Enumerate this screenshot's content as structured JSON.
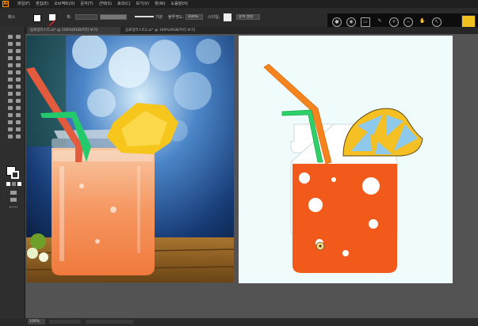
{
  "app": {
    "logo_text": "Ai"
  },
  "menu": {
    "items": [
      "파일(F)",
      "편집(E)",
      "오브젝트(O)",
      "문자(T)",
      "선택(S)",
      "효과(C)",
      "보기(V)",
      "창(W)",
      "도움말(H)"
    ]
  },
  "control_bar": {
    "selection_label": "패스",
    "stroke_label": "획:",
    "brush_label": "기본",
    "opacity_label": "불투명도:",
    "opacity_value": "100%",
    "style_label": "스타일:",
    "doc_setup": "문서 설정"
  },
  "tabs": [
    {
      "label": "음료일러스트.ai* @ 100%(RGB/미리 보기)"
    },
    {
      "label": "음료일러스트2.ai* @ 100%(RGB/미리 보기)"
    }
  ],
  "status": {
    "zoom": "100%"
  },
  "icons": {
    "recorder": [
      "record-icon",
      "camera-icon",
      "window-icon",
      "pen-icon",
      "zoom-in-icon",
      "zoom-out-icon",
      "hand-icon",
      "cursor-icon"
    ]
  },
  "colors": {
    "accent": "#ff9a00",
    "artboard_vector_bg": "#f0fbfb",
    "juice": "#f15a1b",
    "straw_orange": "#f5841f",
    "straw_green": "#2fd06a",
    "lemon_rind": "#f5c023",
    "lemon_flesh": "#8ec8ea"
  }
}
